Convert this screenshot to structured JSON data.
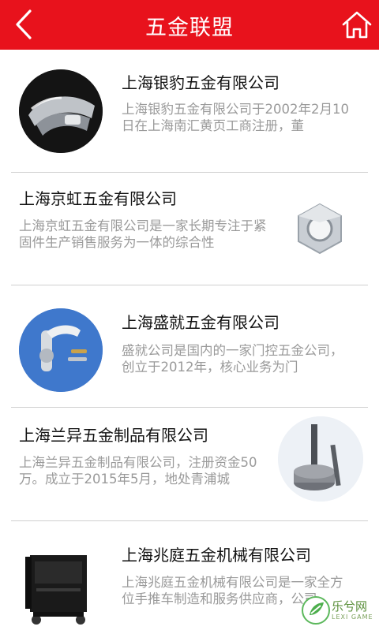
{
  "header": {
    "title": "五金联盟",
    "back_icon": "chevron-left-icon",
    "home_icon": "home-icon",
    "bg_color": "#e8121c"
  },
  "items": [
    {
      "name": "上海银豹五金有限公司",
      "desc": "上海银豹五金有限公司于2002年2月10日在上海南汇黄页工商注册，董"
    },
    {
      "name": "上海京虹五金有限公司",
      "desc": "上海京虹五金有限公司是一家长期专注于紧固件生产销售服务为一体的综合性"
    },
    {
      "name": "上海盛就五金有限公司",
      "desc": "盛就公司是国内的一家门控五金公司，创立于2012年，核心业务为门"
    },
    {
      "name": "上海兰异五金制品有限公司",
      "desc": "上海兰异五金制品有限公司，注册资金50万。成立于2015年5月，地处青浦城"
    },
    {
      "name": "上海兆庭五金机械有限公司",
      "desc": "上海兆庭五金机械有限公司是一家全方位手推车制造和服务供应商，公司"
    }
  ],
  "watermark": {
    "text": "乐兮网",
    "sub": "LEXI GAME"
  }
}
